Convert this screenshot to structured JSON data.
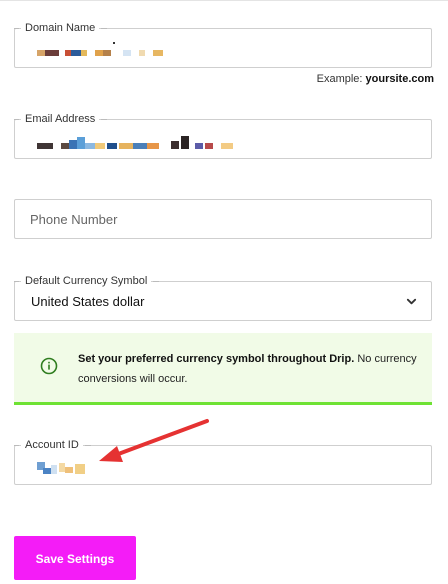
{
  "form": {
    "domain": {
      "label": "Domain Name",
      "hint_prefix": "Example: ",
      "hint_example": "yoursite.com"
    },
    "email": {
      "label": "Email Address"
    },
    "phone": {
      "placeholder": "Phone Number"
    },
    "currency": {
      "label": "Default Currency Symbol",
      "selected": "United States dollar"
    },
    "notice": {
      "bold": "Set your preferred currency symbol throughout Drip.",
      "rest": " No currency conversions will occur."
    },
    "account": {
      "label": "Account ID"
    },
    "save_label": "Save Settings"
  },
  "colors": {
    "accent_button": "#f41cf7",
    "notice_bg": "#f1fbe7",
    "notice_border": "#6ee233",
    "notice_icon": "#2f7d1f",
    "arrow": "#e53232"
  },
  "icons": [
    "chevron-down-icon",
    "info-circle-icon",
    "red-arrow-annotation"
  ]
}
